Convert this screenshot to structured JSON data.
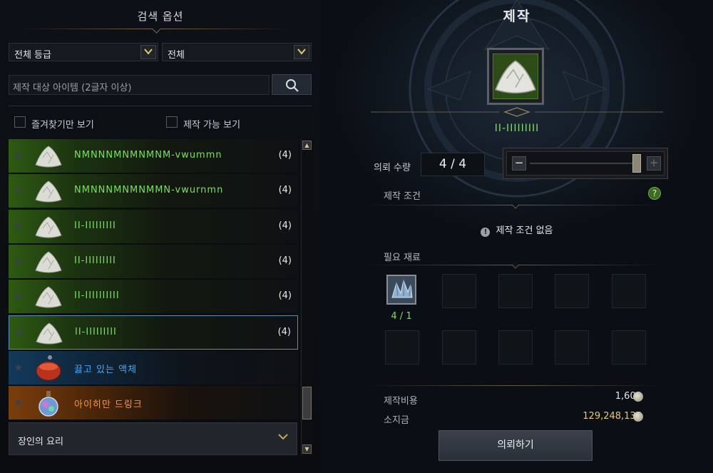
{
  "search_panel": {
    "title": "검색 옵션",
    "grade_dropdown": "전체 등급",
    "category_dropdown": "전체",
    "search_placeholder": "제작 대상 아이템 (2글자 이상)",
    "favorites_only": "즐겨찾기만 보기",
    "craftable_only": "제작 가능 보기"
  },
  "items": [
    {
      "name": "NMNNNMNMNMNM-vwummn",
      "count": "(4)",
      "rarity": "green"
    },
    {
      "name": "NMNNNMNMNMMN-vwurnmn",
      "count": "(4)",
      "rarity": "green"
    },
    {
      "name": "II-IIIIIIIII",
      "count": "(4)",
      "rarity": "green"
    },
    {
      "name": "II-IIIIIIIII",
      "count": "(4)",
      "rarity": "green"
    },
    {
      "name": "II-IIIIIIIIII",
      "count": "(4)",
      "rarity": "green"
    },
    {
      "name": "II-IIIIIIIII",
      "count": "(4)",
      "rarity": "green",
      "selected": true
    },
    {
      "name": "끓고 있는 액체",
      "count": "",
      "rarity": "blue"
    },
    {
      "name": "아이히만 드링크",
      "count": "",
      "rarity": "orange"
    }
  ],
  "category_footer": "장인의 요리",
  "craft": {
    "title": "제작",
    "target_name": "II-IIIIIIIII",
    "quantity_label": "의뢰 수량",
    "quantity_value": "4 / 4",
    "slider_fraction": 1.0,
    "conditions_label": "제작 조건",
    "no_conditions": "제작 조건 없음",
    "materials_label": "필요 재료",
    "material_count": "4 / 1",
    "cost_label": "제작비용",
    "cost_value": "1,600",
    "money_label": "소지금",
    "money_value": "129,248,135",
    "commit_button": "의뢰하기"
  },
  "icons": {
    "dropdown_arrow": "chevron-down-icon",
    "search": "search-icon",
    "favorite": "star-icon",
    "help": "question-icon",
    "info": "info-icon",
    "coin": "silver-coin-icon"
  },
  "colors": {
    "green_rarity": "#7be05a",
    "blue_rarity": "#45a8f0",
    "orange_rarity": "#f09a3c",
    "gold_text": "#e8c86a"
  }
}
